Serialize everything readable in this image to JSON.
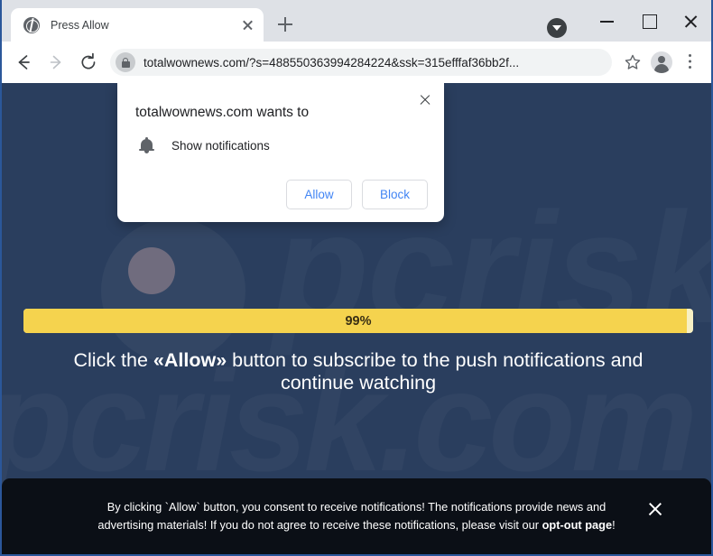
{
  "browser": {
    "tab": {
      "title": "Press Allow",
      "favicon": "globe-icon",
      "close_label": "×"
    },
    "new_tab_label": "+",
    "window_controls": {
      "download_indicator": "download-chevron-icon",
      "minimize": "–",
      "maximize": "□",
      "close": "×"
    },
    "toolbar": {
      "back": "back-arrow-icon",
      "forward": "forward-arrow-icon",
      "reload": "reload-icon",
      "lock": "lock-icon",
      "url": "totalwownews.com/?s=488550363994284224&ssk=315efffaf36bb2f...",
      "bookmark": "star-icon",
      "profile": "avatar-icon",
      "menu": "kebab-menu-icon"
    }
  },
  "permission_dialog": {
    "title": "totalwownews.com wants to",
    "permission_icon": "bell-icon",
    "permission_label": "Show notifications",
    "allow_label": "Allow",
    "block_label": "Block",
    "close_label": "×"
  },
  "page": {
    "watermark": "pcrisk.com",
    "watermark_top": "pcrisk",
    "progress": {
      "value": 99,
      "label": "99%",
      "fill_color": "#f5d34e",
      "track_color": "#f7f0c4"
    },
    "headline": {
      "before": "Click the ",
      "emphasis": "«Allow»",
      "after": " button to subscribe to the push notifications and continue watching"
    },
    "background_color": "#2a3e5e"
  },
  "consent_banner": {
    "text_before": "By clicking `Allow` button, you consent to receive notifications! The notifications provide news and advertising materials! If you do not agree to receive these notifications, please visit our ",
    "link_text": "opt-out page",
    "text_after": "!",
    "close_label": "×",
    "background_color": "#0b0f16"
  }
}
